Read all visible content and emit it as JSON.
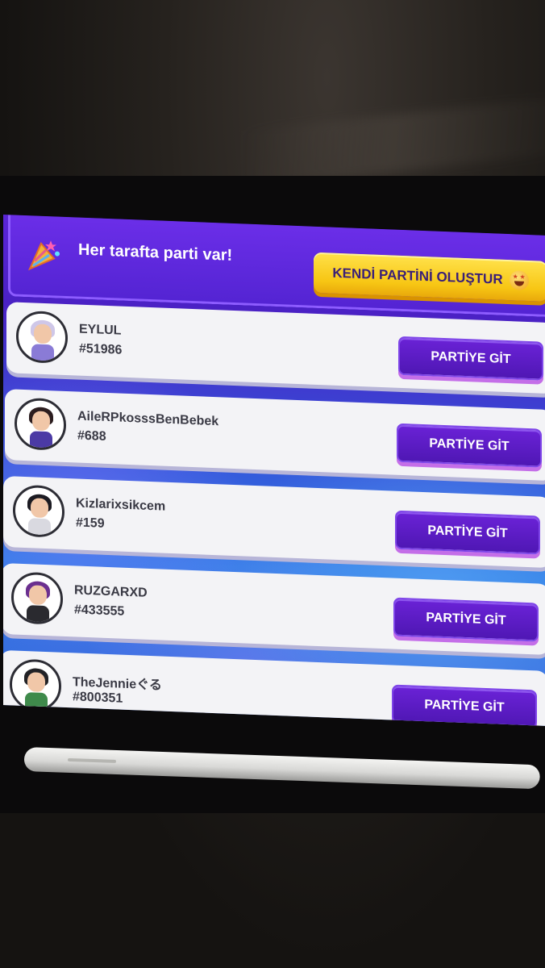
{
  "header": {
    "title": "Her tarafta parti var!",
    "create_button_label": "KENDİ PARTİNİ OLUŞTUR"
  },
  "parties": [
    {
      "name": "EYLUL",
      "id": "#51986",
      "button": "PARTİYE GİT",
      "hair": "#cfc7e8",
      "body": "#8a7bd6"
    },
    {
      "name": "AileRPkosssBenBebek",
      "id": "#688",
      "button": "PARTİYE GİT",
      "hair": "#2b1d1f",
      "body": "#4b3aa5"
    },
    {
      "name": "Kizlarixsikcem",
      "id": "#159",
      "button": "PARTİYE GİT",
      "hair": "#1c1b22",
      "body": "#d9d9e0"
    },
    {
      "name": "RUZGARXD",
      "id": "#433555",
      "button": "PARTİYE GİT",
      "hair": "#6b2f8f",
      "body": "#2a2a2f"
    },
    {
      "name": "TheJennieぐる",
      "id": "#800351",
      "button": "PARTİYE GİT",
      "hair": "#222226",
      "body": "#3f8a4b"
    }
  ]
}
